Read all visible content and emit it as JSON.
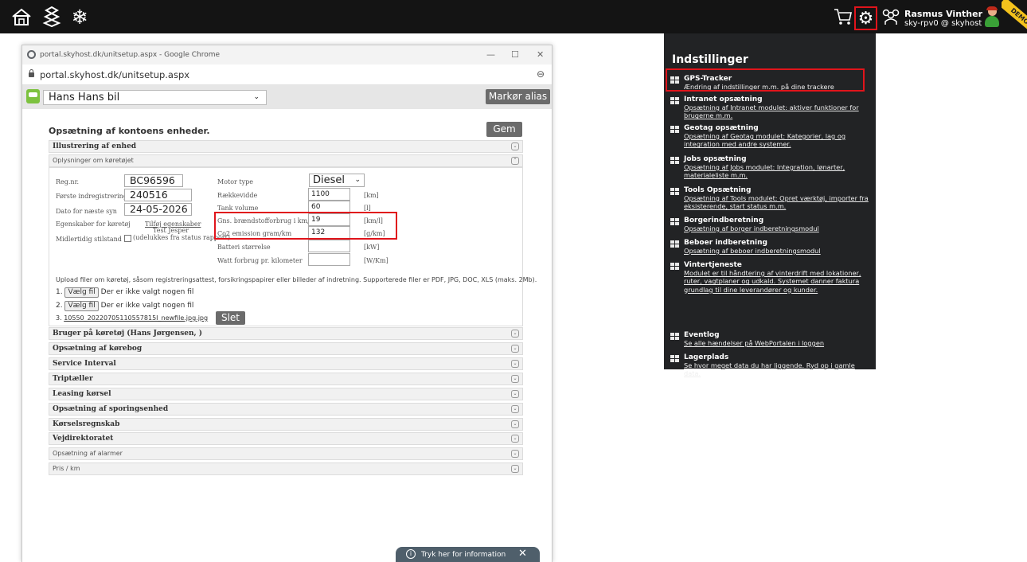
{
  "topbar": {
    "user_name": "Rasmus Vinther",
    "user_account": "sky-rpv0 @ skyhost",
    "demo_badge": "DEMO",
    "icons": [
      "home-icon",
      "road-icon",
      "snowflake-icon",
      "cart-icon",
      "gear-icon",
      "users-icon",
      "avatar"
    ]
  },
  "browser": {
    "title": "portal.skyhost.dk/unitsetup.aspx - Google Chrome",
    "address": "portal.skyhost.dk/unitsetup.aspx"
  },
  "vehicle_bar": {
    "selected_vehicle": "Hans Hans bil",
    "alias_button": "Markør alias"
  },
  "page": {
    "title": "Opsætning af kontoens enheder.",
    "save_button": "Gem",
    "sections_top": [
      "Illustrering af enhed",
      "Oplysninger om køretøjet"
    ],
    "vehicle_info": {
      "reg_label": "Reg.nr.",
      "reg_value": "BC96596",
      "first_reg_label": "Første indregistrering",
      "first_reg_value": "240516",
      "next_inspection_label": "Dato for næste syn",
      "next_inspection_value": "24-05-2026",
      "props_label": "Egenskaber for køretøj",
      "props_link": "Tilføj egenskaber",
      "props_value": "Test Jesper",
      "temp_label": "Midlertidig stilstand",
      "temp_checkbox": "(udelukkes fra status rapport)",
      "motor_label": "Motor type",
      "motor_value": "Diesel",
      "range_label": "Rækkevidde",
      "range_value": "1100",
      "range_unit": "[km]",
      "tank_label": "Tank volume",
      "tank_value": "60",
      "tank_unit": "[l]",
      "fuel_label": "Gns. brændstofforbrug i km/l",
      "fuel_value": "19",
      "fuel_unit": "[km/l]",
      "co2_label": "Co2 emission gram/km",
      "co2_value": "132",
      "co2_unit": "[g/km]",
      "battery_label": "Batteri størrelse",
      "battery_value": "",
      "battery_unit": "[kW]",
      "watt_label": "Watt forbrug pr. kilometer",
      "watt_value": "",
      "watt_unit": "[W/Km]"
    },
    "upload": {
      "description": "Upload filer om køretøj, såsom registreringsattest, forsikringspapirer eller billeder af indretning. Supporterede filer er PDF, JPG, DOC, XLS (maks. 2Mb).",
      "row1_num": "1.",
      "row2_num": "2.",
      "row3_num": "3.",
      "choose_button": "Vælg fil",
      "no_file": "Der er ikke valgt nogen fil",
      "existing_file": "10550_20220705110557815I_newfile.jpg.jpg",
      "delete_button": "Slet"
    },
    "sections": [
      "Bruger på køretøj (Hans Jørgensen, )",
      "Opsætning af kørebog",
      "Service Interval",
      "Triptæller",
      "Leasing kørsel",
      "Opsætning af sporingsenhed",
      "Kørselsregnskab",
      "Vejdirektoratet",
      "Opsætning af alarmer",
      "Pris / km"
    ]
  },
  "toast": {
    "text": "Tryk her for information"
  },
  "settings_menu": {
    "title": "Indstillinger",
    "items": [
      {
        "name": "GPS-Tracker",
        "desc": "Ændring af indstillinger m.m. på dine trackere"
      },
      {
        "name": "Intranet opsætning",
        "desc": "Opsætning af Intranet modulet: aktiver funktioner for brugerne m.m."
      },
      {
        "name": "Geotag opsætning",
        "desc": "Opsætning af Geotag modulet: Kategorier, lag og integration med andre systemer."
      },
      {
        "name": "Jobs opsætning",
        "desc": "Opsætning af Jobs modulet: Integration, lønarter, materialeliste m.m."
      },
      {
        "name": "Tools Opsætning",
        "desc": "Opsætning af Tools modulet: Opret værktøj, importer fra eksisterende, start status m.m."
      },
      {
        "name": "Borgerindberetning",
        "desc": "Opsætning af borger indberetningsmodul"
      },
      {
        "name": "Beboer indberetning",
        "desc": "Opsætning af beboer indberetningsmodul"
      },
      {
        "name": "Vintertjeneste",
        "desc": "Modulet er til håndtering af vinterdrift med lokationer, ruter, vagtplaner og udkald. Systemet danner faktura grundlag til dine leverandører og kunder."
      },
      {
        "name": "Eventlog",
        "desc": "Se alle hændelser på WebPortalen i loggen"
      },
      {
        "name": "Lagerplads",
        "desc": "Se hvor meget data du har liggende. Ryd op i gamle data."
      }
    ]
  },
  "colors": {
    "topbar": "#141414",
    "menu_bg": "#222325",
    "highlight": "#e0141b",
    "button": "#6b6b6b"
  }
}
